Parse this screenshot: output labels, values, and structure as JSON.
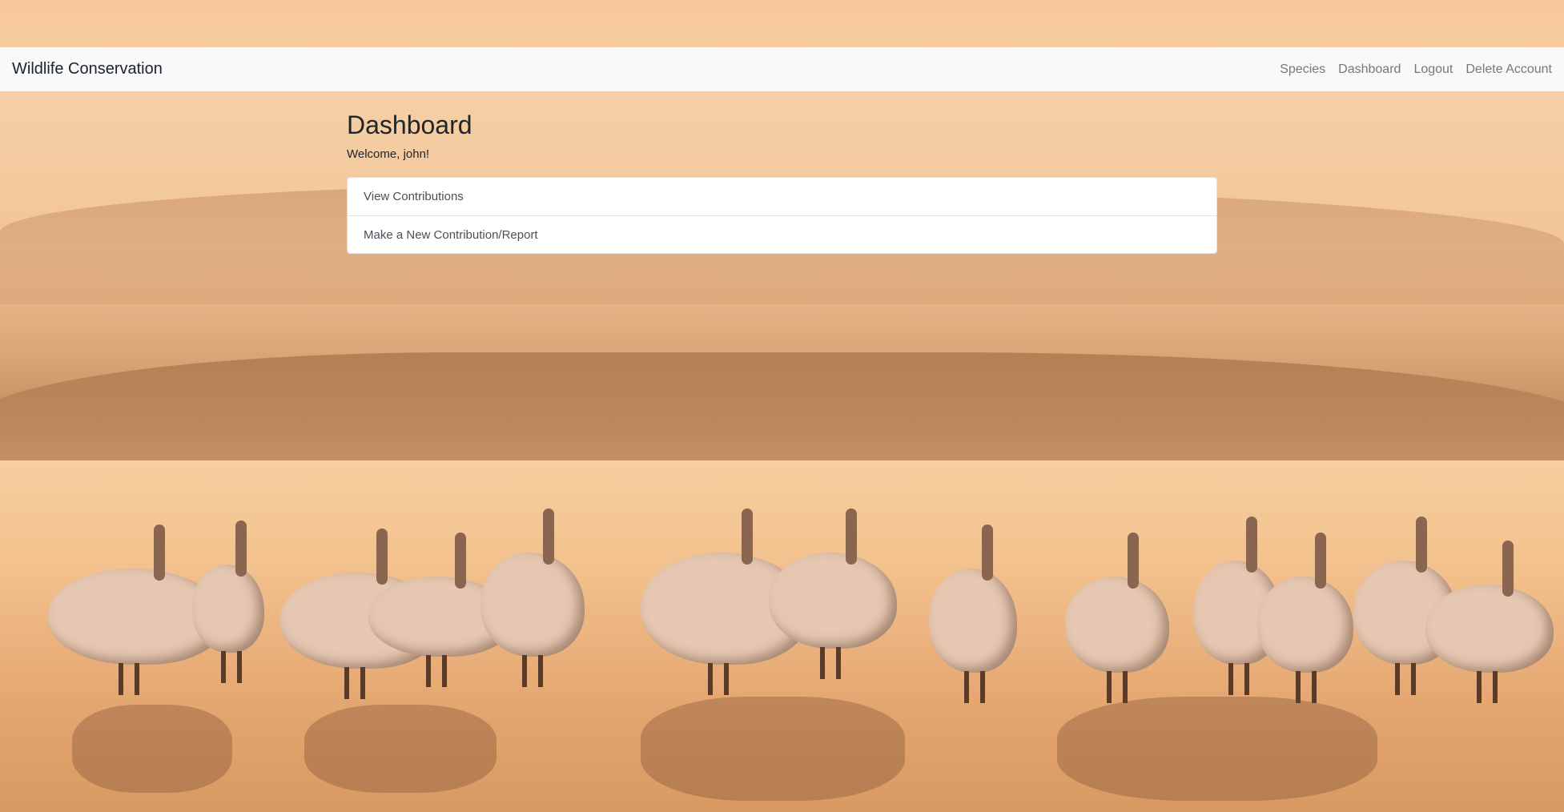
{
  "navbar": {
    "brand": "Wildlife Conservation",
    "links": {
      "species": "Species",
      "dashboard": "Dashboard",
      "logout": "Logout",
      "delete_account": "Delete Account"
    }
  },
  "main": {
    "title": "Dashboard",
    "welcome": "Welcome, john!",
    "actions": {
      "view_contributions": "View Contributions",
      "new_contribution": "Make a New Contribution/Report"
    }
  },
  "background": {
    "subject": "pelicans",
    "colors": {
      "sky": "#f7c89a",
      "water": "#f3c18d",
      "navbar": "#f8f9fa"
    }
  }
}
